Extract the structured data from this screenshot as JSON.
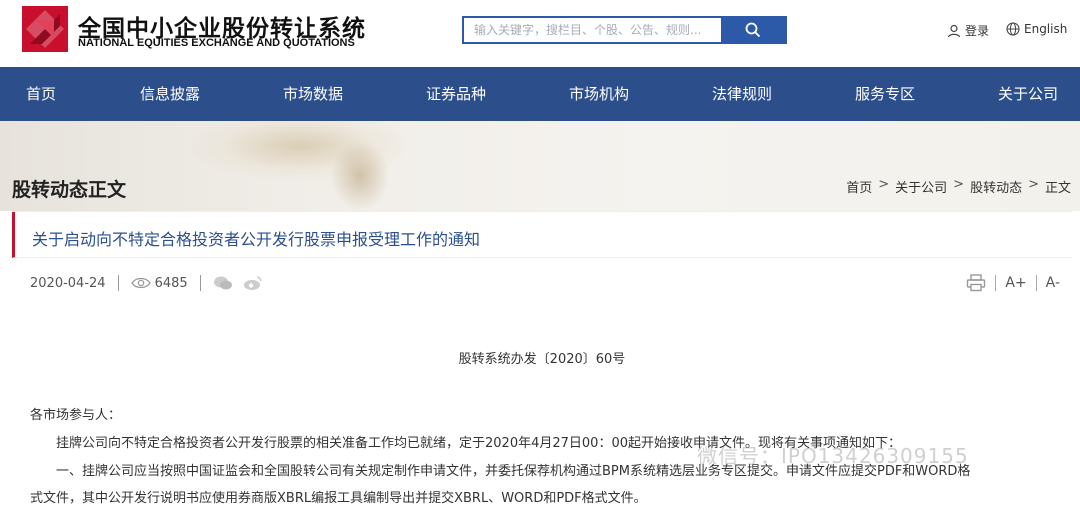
{
  "header": {
    "logo_cn": "全国中小企业股份转让系统",
    "logo_en": "NATIONAL EQUITIES EXCHANGE AND QUOTATIONS",
    "search_placeholder": "输入关键字，搜栏目、个股、公告、规则...",
    "login": "登录",
    "english": "English"
  },
  "nav": [
    "首页",
    "信息披露",
    "市场数据",
    "证券品种",
    "市场机构",
    "法律规则",
    "服务专区",
    "关于公司"
  ],
  "banner": {
    "page_title": "股转动态正文",
    "breadcrumb": [
      "首页",
      "关于公司",
      "股转动态",
      "正文"
    ]
  },
  "article": {
    "title": "关于启动向不特定合格投资者公开发行股票申报受理工作的通知",
    "date": "2020-04-24",
    "views": "6485",
    "doc_no": "股转系统办发〔2020〕60号",
    "paragraphs": [
      "各市场参与人：",
      "　　挂牌公司向不特定合格投资者公开发行股票的相关准备工作均已就绪，定于2020年4月27日00：00起开始接收申请文件。现将有关事项通知如下：",
      "　　一、挂牌公司应当按照中国证监会和全国股转公司有关规定制作申请文件，并委托保荐机构通过BPM系统精选层业务专区提交。申请文件应提交PDF和WORD格",
      "式文件，其中公开发行说明书应使用券商版XBRL编报工具编制导出并提交XBRL、WORD和PDF格式文件。"
    ],
    "tools": [
      "A+",
      "A-"
    ]
  },
  "watermark": "微信号：IPO13426309155",
  "colors": {
    "nav_bg": "#2c4f8c",
    "accent_red": "#c8102e",
    "title_blue": "#2b4f8f",
    "search_blue": "#2d5aa8"
  }
}
